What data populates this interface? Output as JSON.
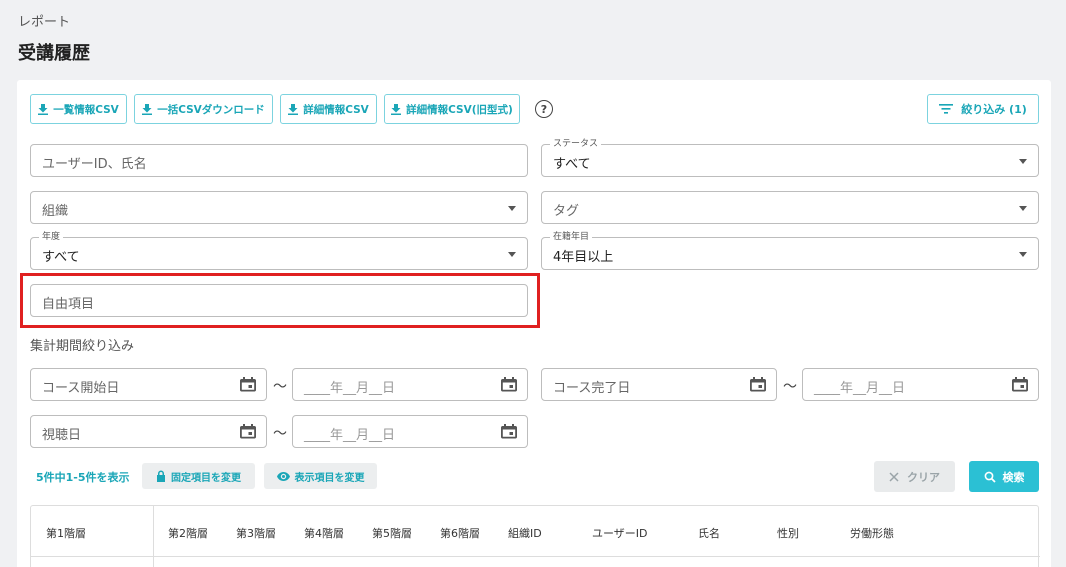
{
  "breadcrumb": "レポート",
  "title": "受講履歴",
  "toolbar": {
    "btn1": "一覧情報CSV",
    "btn2": "一括CSVダウンロード",
    "btn3": "詳細情報CSV",
    "btn4": "詳細情報CSV(旧型式)",
    "help": "?",
    "filter": "絞り込み (1)"
  },
  "filters": {
    "user_placeholder": "ユーザーID、氏名",
    "status_label": "ステータス",
    "status_value": "すべて",
    "org_placeholder": "組織",
    "tag_placeholder": "タグ",
    "year_label": "年度",
    "year_value": "すべて",
    "tenure_label": "在籍年目",
    "tenure_value": "4年目以上",
    "free_placeholder": "自由項目"
  },
  "period": {
    "label": "集計期間絞り込み",
    "course_start": "コース開始日",
    "course_end": "コース完了日",
    "view_date": "視聴日",
    "date_placeholder": "____年__月__日",
    "tilde": "〜"
  },
  "results": {
    "count": "5件中1-5件を表示",
    "fixed_btn": "固定項目を変更",
    "display_btn": "表示項目を変更",
    "clear": "クリア",
    "search": "検索"
  },
  "table": {
    "headers": [
      "第1階層",
      "第2階層",
      "第3階層",
      "第4階層",
      "第5階層",
      "第6階層",
      "組織ID",
      "ユーザーID",
      "氏名",
      "性別",
      "労働形態"
    ]
  },
  "colors": {
    "accent": "#1aa6b7",
    "primary": "#2bc0d4",
    "highlight": "#e02020"
  }
}
